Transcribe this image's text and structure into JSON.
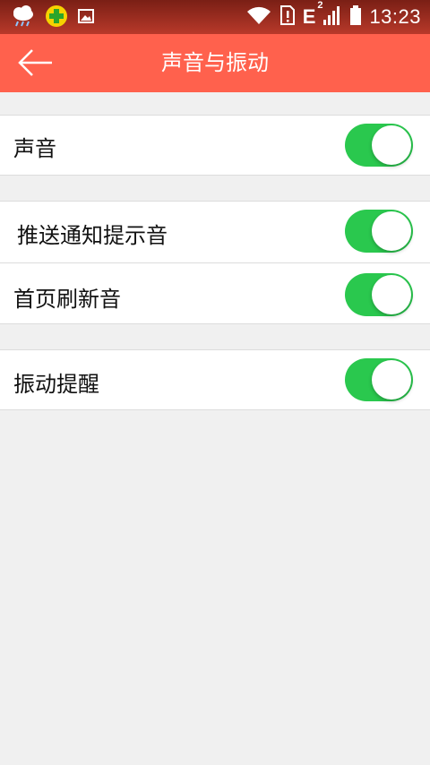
{
  "status_bar": {
    "time": "13:23",
    "network_type": "E",
    "network_sup": "2"
  },
  "header": {
    "title": "声音与振动",
    "accent_color": "#ff614d"
  },
  "settings": [
    {
      "label": "声音",
      "enabled": true
    },
    {
      "label": "推送通知提示音",
      "enabled": true
    },
    {
      "label": "首页刷新音",
      "enabled": true
    },
    {
      "label": "振动提醒",
      "enabled": true
    }
  ],
  "toggle_on_color": "#2ac84e"
}
